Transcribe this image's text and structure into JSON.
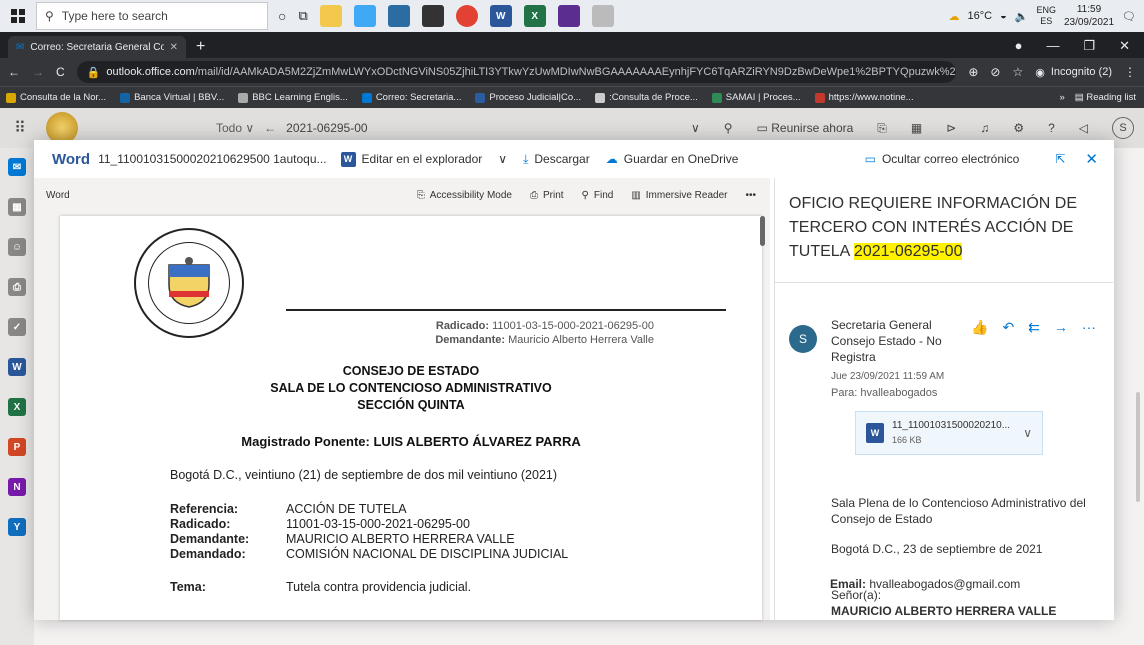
{
  "taskbar": {
    "search_placeholder": "Type here to search",
    "weather": "16°C",
    "lang_top": "ENG",
    "lang_bottom": "ES",
    "time": "11:59",
    "date": "23/09/2021"
  },
  "browser": {
    "tab_title": "Correo: Secretaria General Conse",
    "url_host": "outlook.office.com",
    "url_path": "/mail/id/AAMkADA5M2ZjZmMwLWYxODctNGViNS05ZjhiLTI3YTkwYzUwMDIwNwBGAAAAAAAEynhjFYC6TqARZiRYN9DzBwDeWpe1%2BPTYQpuzwk%2BEsDH0AAA...",
    "incognito_label": "Incognito (2)",
    "bookmarks": [
      "Consulta de la Nor...",
      "Banca Virtual | BBV...",
      "BBC Learning Englis...",
      "Correo: Secretaria...",
      "Proceso Judicial|Co...",
      ":Consulta de Proce...",
      "SAMAI | Proces...",
      "https://www.notine..."
    ],
    "reading_list": "Reading list"
  },
  "outlook": {
    "scope": "Todo",
    "query": "2021-06295-00",
    "meet_now": "Reunirse ahora",
    "avatar_initial": "S"
  },
  "modal": {
    "app_name": "Word",
    "file_name": "11_11001031500020210629500 1autoqu...",
    "edit_in_browser": "Editar en el explorador",
    "download": "Descargar",
    "save_onedrive": "Guardar en OneDrive",
    "hide_email": "Ocultar correo electrónico",
    "viewer_label": "Word",
    "accessibility": "Accessibility Mode",
    "print": "Print",
    "find": "Find",
    "immersive": "Immersive Reader",
    "more": "•••"
  },
  "document": {
    "radicado_label": "Radicado:",
    "radicado_value": "11001-03-15-000-2021-06295-00",
    "demandante_label": "Demandante:",
    "demandante_value": "Mauricio Alberto Herrera Valle",
    "heading1": "CONSEJO DE ESTADO",
    "heading2": "SALA DE LO CONTENCIOSO ADMINISTRATIVO",
    "heading3": "SECCIÓN QUINTA",
    "magistrado": "Magistrado Ponente: LUIS ALBERTO ÁLVAREZ PARRA",
    "fecha": "Bogotá D.C., veintiuno (21) de septiembre de dos mil veintiuno (2021)",
    "refs": [
      {
        "k": "Referencia:",
        "v": "ACCIÓN DE TUTELA"
      },
      {
        "k": "Radicado:",
        "v": "11001-03-15-000-2021-06295-00"
      },
      {
        "k": "Demandante:",
        "v": "MAURICIO ALBERTO HERRERA VALLE"
      },
      {
        "k": "Demandado:",
        "v": "COMISIÓN NACIONAL DE DISCIPLINA JUDICIAL"
      }
    ],
    "tema_label": "Tema:",
    "tema_value": "Tutela contra providencia judicial."
  },
  "email": {
    "subject_text": "OFICIO REQUIERE INFORMACIÓN DE TERCERO CON INTERÉS ACCIÓN DE TUTELA",
    "subject_highlight": "2021-06295-00",
    "sender_initial": "S",
    "sender_name": "Secretaria General Consejo Estado - No Registra",
    "date": "Jue 23/09/2021 11:59 AM",
    "to": "Para: hvalleabogados",
    "attachment_name": "11_11001031500020210...",
    "attachment_size": "166 KB",
    "body_line1": "Sala Plena de lo Contencioso Administrativo del Consejo de Estado",
    "body_line2": "Bogotá D.C., 23 de septiembre de 2021",
    "body_line3": "Señor(a):",
    "body_name": "MAURICIO ALBERTO HERRERA VALLE",
    "body_email_label": "Email:",
    "body_email_value": "hvalleabogados@gmail.com"
  },
  "colors": {
    "word_blue": "#2b579a",
    "outlook_blue": "#0078d4",
    "highlight": "#fff100"
  }
}
